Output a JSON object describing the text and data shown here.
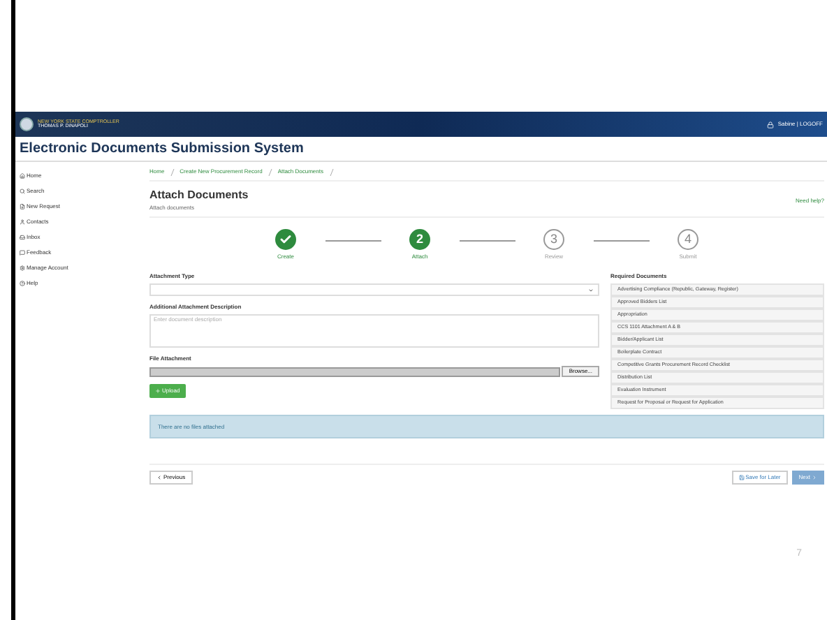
{
  "header": {
    "agency": "NEW YORK STATE COMPTROLLER",
    "official": "THOMAS P. DiNAPOLI",
    "user": "Sabine | LOGOFF"
  },
  "app_title": "Electronic Documents Submission System",
  "sidebar": {
    "items": [
      {
        "label": "Home"
      },
      {
        "label": "Search"
      },
      {
        "label": "New Request"
      },
      {
        "label": "Contacts"
      },
      {
        "label": "Inbox"
      },
      {
        "label": "Feedback"
      },
      {
        "label": "Manage Account"
      },
      {
        "label": "Help"
      }
    ]
  },
  "breadcrumb": [
    "Home",
    "Create New Procurement Record",
    "Attach Documents"
  ],
  "page": {
    "title": "Attach Documents",
    "subtitle": "Attach documents",
    "help_link": "Need help?"
  },
  "steps": [
    {
      "label": "Create",
      "completed": true,
      "selected": false
    },
    {
      "label": "Attach",
      "number": "2",
      "completed": false,
      "selected": true
    },
    {
      "label": "Review",
      "number": "3",
      "completed": false,
      "selected": false
    },
    {
      "label": "Submit",
      "number": "4",
      "completed": false,
      "selected": false
    }
  ],
  "form": {
    "attachment_type_label": "Attachment Type",
    "description_label": "Additional Attachment Description",
    "description_placeholder": "Enter document description",
    "file_label": "File Attachment",
    "browse_button": "Browse...",
    "upload_button": "Upload"
  },
  "required_documents": {
    "title": "Required Documents",
    "items": [
      "Advertising Compliance (Republic, Gateway, Register)",
      "Approved Bidders List",
      "Appropriation",
      "CCS 1101 Attachment A & B",
      "Bidder/Applicant List",
      "Boilerplate Contract",
      "Competitive Grants Procurement Record Checklist",
      "Distribution List",
      "Evaluation Instrument",
      "Request for Proposal or Request for Application"
    ]
  },
  "alert": "There are no files attached",
  "buttons": {
    "previous": "Previous",
    "save": "Save for Later",
    "next": "Next"
  },
  "slide_number": "7"
}
